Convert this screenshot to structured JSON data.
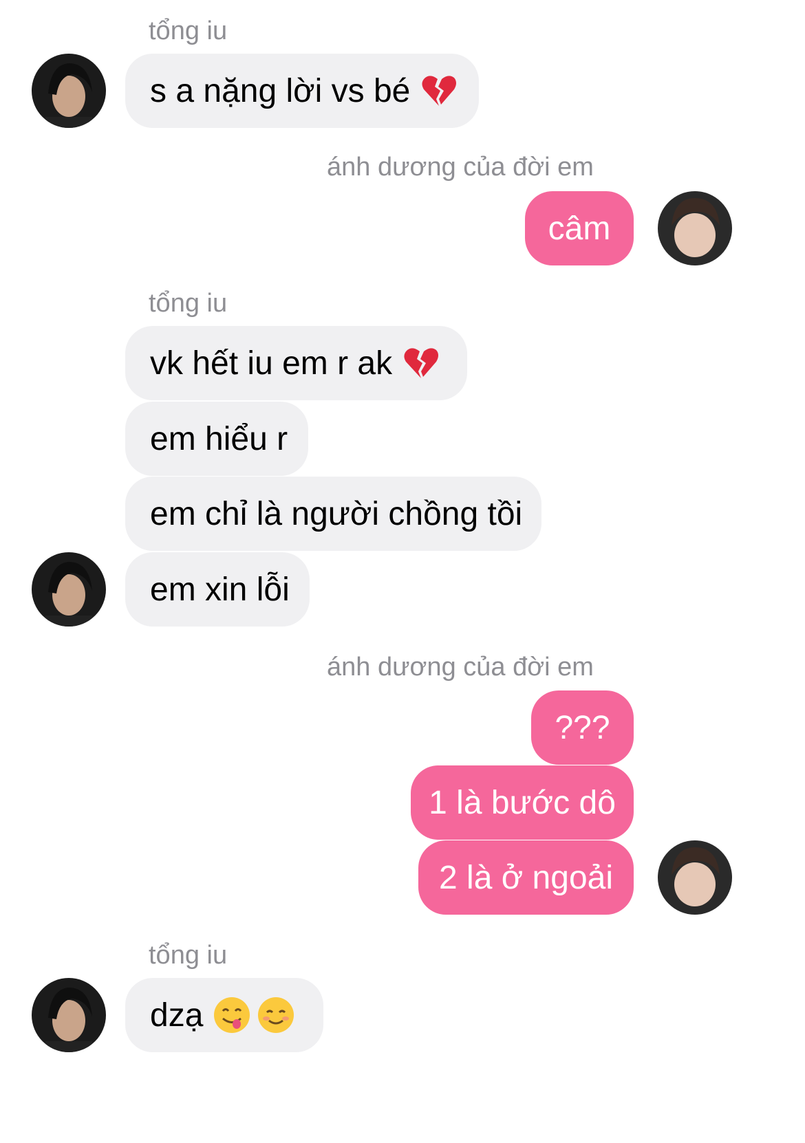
{
  "contacts": {
    "incoming_name": "tổng iu",
    "outgoing_name": "ánh dương của đời em"
  },
  "groups": [
    {
      "sender": "tổng iu",
      "messages": [
        {
          "text": "s a nặng lời vs bé",
          "emoji": "broken-heart"
        }
      ]
    },
    {
      "sender": "ánh dương của đời em",
      "messages": [
        {
          "text": "câm"
        }
      ]
    },
    {
      "sender": "tổng iu",
      "messages": [
        {
          "text": "vk hết iu em r ak",
          "emoji": "broken-heart"
        },
        {
          "text": "em hiểu r"
        },
        {
          "text": "em chỉ là người chồng tồi"
        },
        {
          "text": "em xin lỗi"
        }
      ]
    },
    {
      "sender": "ánh dương của đời em",
      "messages": [
        {
          "text": "???"
        },
        {
          "text": "1 là bước dô"
        },
        {
          "text": "2 là ở ngoải"
        }
      ]
    },
    {
      "sender": "tổng iu",
      "messages": [
        {
          "text": "dzạ",
          "emoji": [
            "face-savoring-food",
            "smiling-face"
          ]
        }
      ]
    }
  ],
  "colors": {
    "incoming_bubble": "#f0f0f2",
    "outgoing_bubble": "#f5679b",
    "sender_label": "#8e8e93"
  }
}
